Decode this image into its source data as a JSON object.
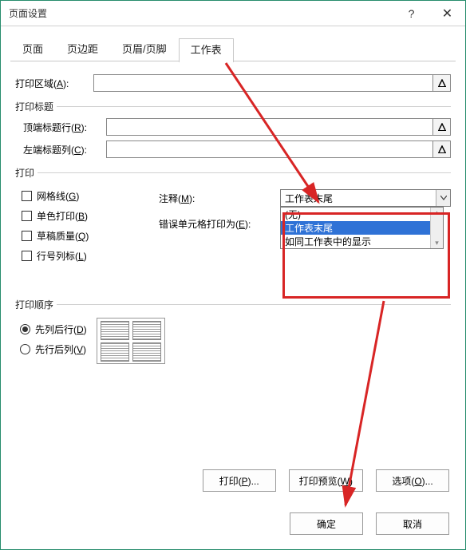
{
  "title": "页面设置",
  "tabs": {
    "page": "页面",
    "margins": "页边距",
    "header_footer": "页眉/页脚",
    "sheet": "工作表"
  },
  "print_area": {
    "label": "打印区域(A):",
    "value": ""
  },
  "titles_group": "打印标题",
  "top_rows": {
    "label": "顶端标题行(R):",
    "value": ""
  },
  "left_cols": {
    "label": "左端标题列(C):",
    "value": ""
  },
  "print_group": "打印",
  "checks": {
    "gridlines": "网格线(G)",
    "bw": "单色打印(B)",
    "draft": "草稿质量(Q)",
    "rowcol": "行号列标(L)"
  },
  "comments": {
    "label": "注释(M):",
    "value": "工作表末尾"
  },
  "errors": {
    "label": "错误单元格打印为(E):"
  },
  "dropdown": {
    "opt_none": "(无)",
    "opt_end": "工作表末尾",
    "opt_displayed": "如同工作表中的显示"
  },
  "order_group": "打印顺序",
  "order": {
    "down_over": "先列后行(D)",
    "over_down": "先行后列(V)"
  },
  "buttons": {
    "print": "打印(P)...",
    "preview": "打印预览(W)",
    "options": "选项(O)..."
  },
  "ok": "确定",
  "cancel": "取消"
}
